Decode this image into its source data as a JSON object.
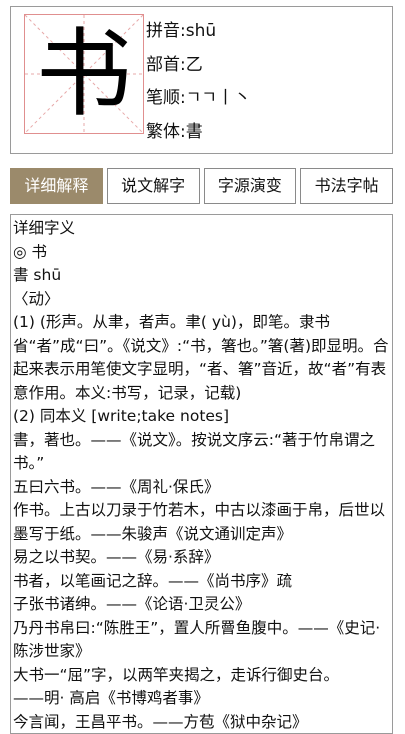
{
  "character": "书",
  "info": {
    "pinyin": "拼音:shū",
    "radical": "部首:乙",
    "strokes": "笔顺:ㄱㄱ丨丶",
    "traditional": "繁体:書"
  },
  "tabs": [
    {
      "label": "详细解释",
      "active": true
    },
    {
      "label": "说文解字",
      "active": false
    },
    {
      "label": "字源演变",
      "active": false
    },
    {
      "label": "书法字帖",
      "active": false
    }
  ],
  "content": {
    "lines": [
      "详细字义",
      "◎ 书",
      "書 shū",
      "〈动〉",
      "(1) (形声。从聿，者声。聿( yù)，即笔。隶书省“者”成“曰”。《说文》:“书，箸也。”箸(著)即显明。合起来表示用笔使文字显明，“者、箸”音近，故“者”有表意作用。本义:书写，记录，记载)",
      "(2) 同本义 [write;take notes]",
      "書，著也。——《说文》。按说文序云:“著于竹帛谓之书。”",
      "五曰六书。——《周礼·保氏》",
      "作书。上古以刀录于竹若木，中古以漆画于帛，后世以墨写于纸。——朱骏声《说文通训定声》",
      "易之以书契。——《易·系辞》",
      "书者，以笔画记之辞。——《尚书序》疏",
      "子张书诸绅。——《论语·卫灵公》",
      "乃丹书帛曰:“陈胜王”，置人所罾鱼腹中。——《史记·陈涉世家》",
      "大书一“屈”字，以两竿夹揭之，走诉行御史台。",
      "——明· 高启《书博鸡者事》",
      "今言闻，王昌平书。——方苞《狱中杂记》"
    ]
  }
}
